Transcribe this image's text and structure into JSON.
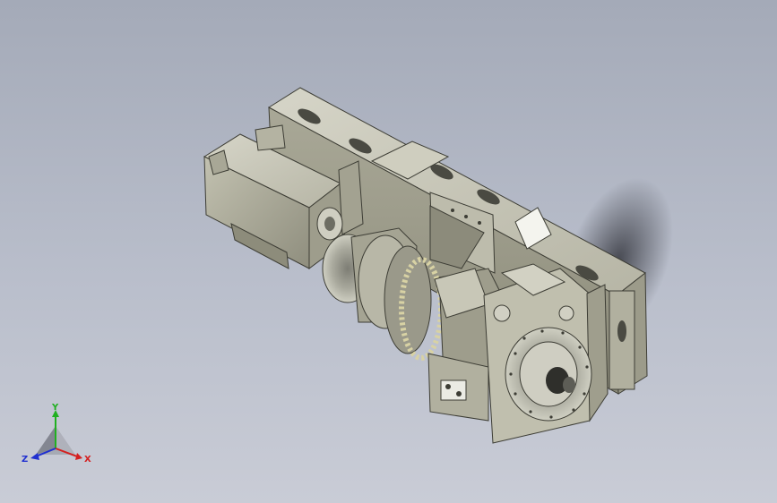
{
  "triad": {
    "x_label": "X",
    "y_label": "Y",
    "z_label": "Z"
  },
  "colors": {
    "background_top": "#a4aab8",
    "background_bottom": "#c9ccd6",
    "part_body": "#b9b8a8",
    "part_shadow": "#5a5a50",
    "axis_x": "#d42020",
    "axis_y": "#20b020",
    "axis_z": "#2030d0"
  },
  "icons": {
    "triad": "xyz-axis-triad-icon"
  }
}
